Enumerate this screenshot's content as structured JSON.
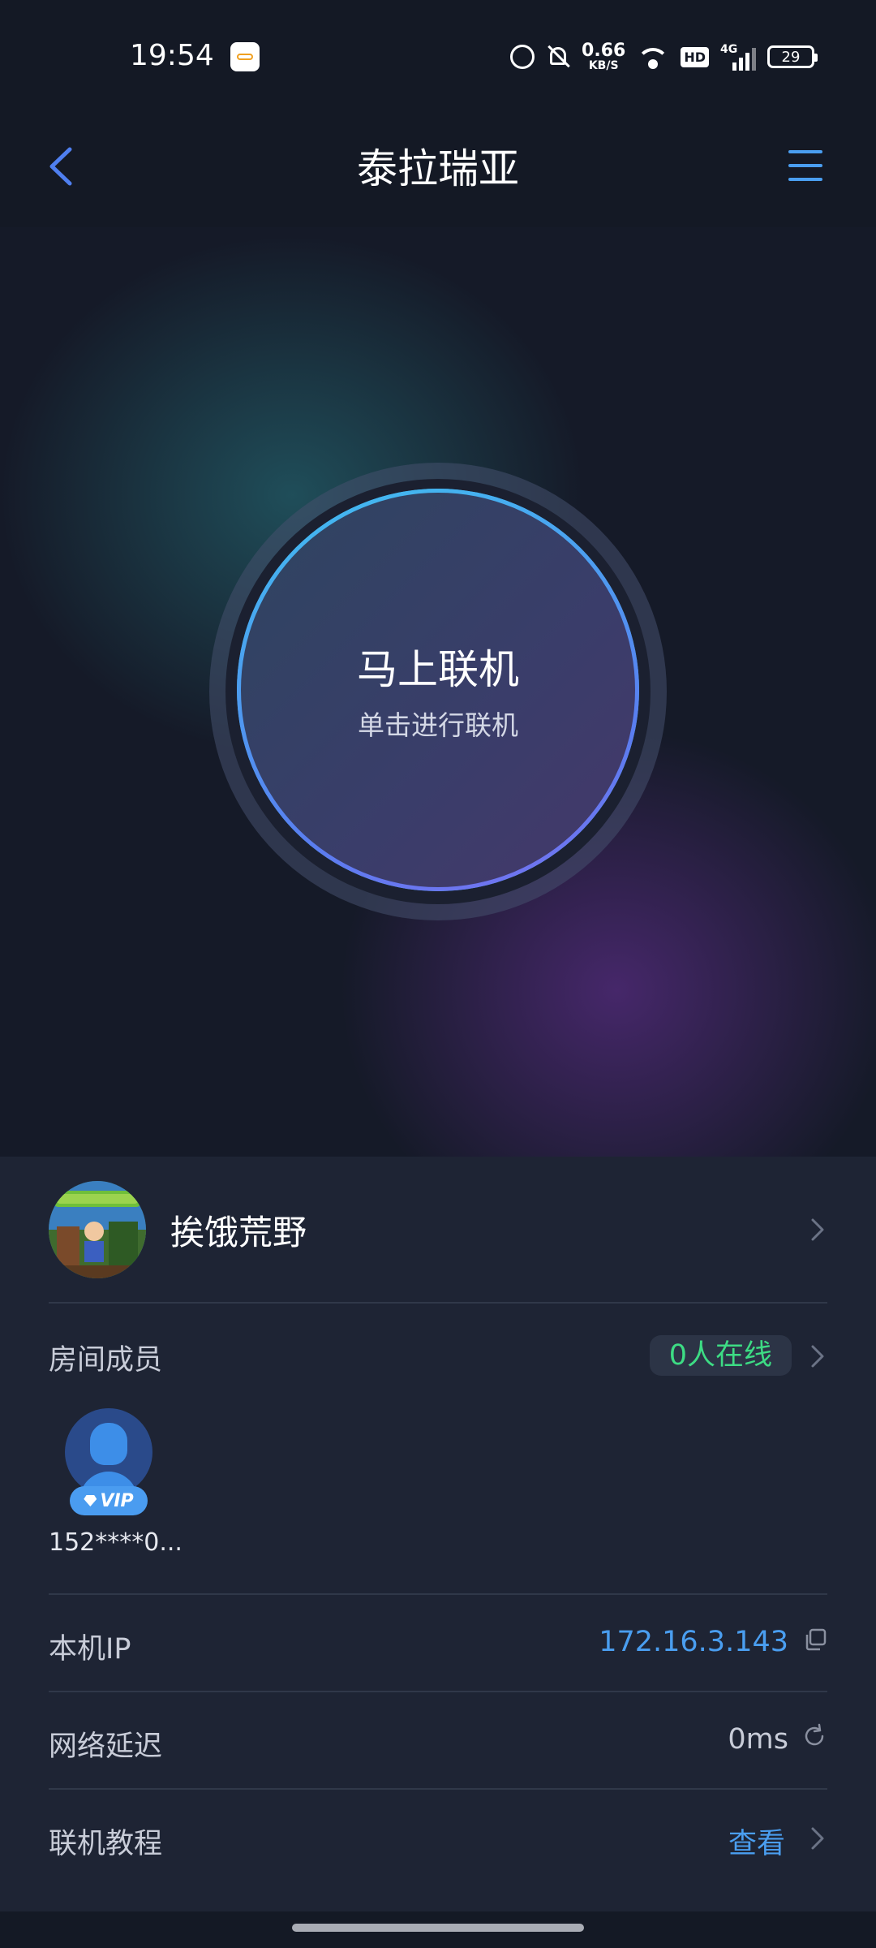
{
  "status_bar": {
    "time": "19:54",
    "speed_value": "0.66",
    "speed_unit": "KB/S",
    "hd": "HD",
    "network": "4G",
    "battery": "29",
    "icons": [
      "alarm-icon",
      "mute-icon",
      "wifi-icon",
      "signal-icon",
      "battery-icon"
    ]
  },
  "header": {
    "title": "泰拉瑞亚",
    "back_icon": "chevron-left-icon",
    "menu_icon": "menu-icon"
  },
  "connect": {
    "title": "马上联机",
    "subtitle": "单击进行联机"
  },
  "game": {
    "name": "挨饿荒野"
  },
  "room": {
    "label": "房间成员",
    "online": "0人在线",
    "members": [
      {
        "name": "152****0...",
        "badge": "VIP"
      }
    ]
  },
  "ip": {
    "label": "本机IP",
    "value": "172.16.3.143"
  },
  "latency": {
    "label": "网络延迟",
    "value": "0ms"
  },
  "tutorial": {
    "label": "联机教程",
    "link": "查看"
  },
  "colors": {
    "accent_blue": "#4a9ef0",
    "online_green": "#3ddc84",
    "panel_bg": "#1e2434",
    "page_bg": "#141925"
  }
}
